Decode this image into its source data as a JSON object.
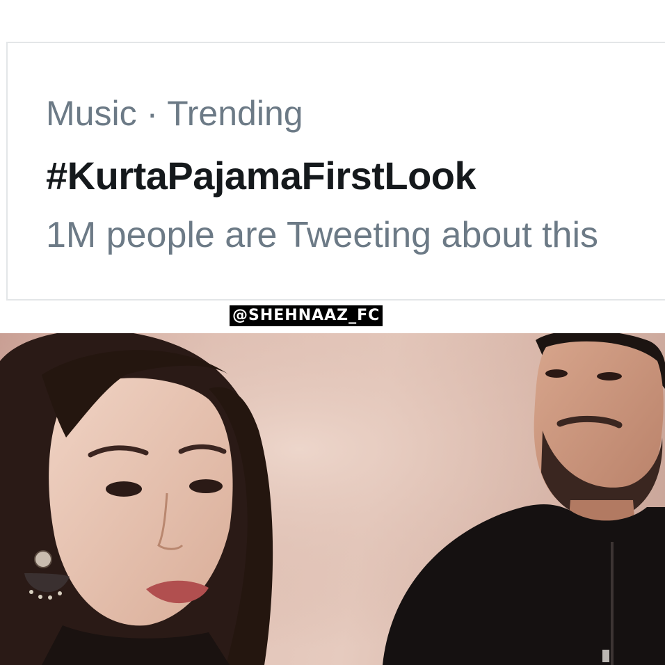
{
  "trend": {
    "context": "Music · Trending",
    "hashtag": "#KurtaPajamaFirstLook",
    "count_text": "1M people are Tweeting about this"
  },
  "watermark": {
    "text": "@SHEHNAAZ_FC"
  },
  "colors": {
    "muted_text": "#6c7a86",
    "primary_text": "#15191c",
    "card_border": "#e3e6e8",
    "photo_background": "#e1c2b6",
    "watermark_bg": "#000000"
  },
  "photo": {
    "left_subject": "woman-portrait",
    "right_subject": "man-portrait"
  }
}
